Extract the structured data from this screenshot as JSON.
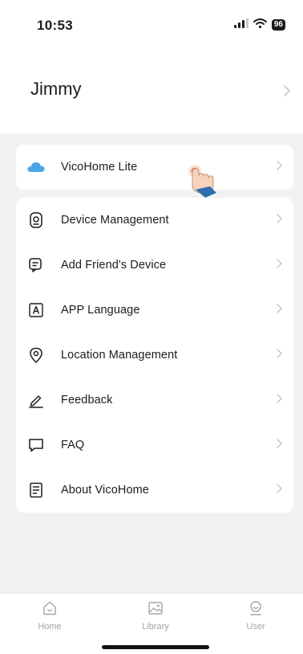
{
  "status_bar": {
    "time": "10:53",
    "battery": "96",
    "icons": [
      "signal-icon",
      "wifi-icon",
      "battery-icon"
    ]
  },
  "header": {
    "user_name": "Jimmy"
  },
  "top_card": {
    "label": "VicoHome Lite",
    "icon": "cloud-icon"
  },
  "menu": {
    "items": [
      {
        "label": "Device Management",
        "icon": "camera-icon"
      },
      {
        "label": "Add Friend's Device",
        "icon": "share-device-icon"
      },
      {
        "label": "APP Language",
        "icon": "language-icon"
      },
      {
        "label": "Location Management",
        "icon": "location-pin-icon"
      },
      {
        "label": "Feedback",
        "icon": "pen-icon"
      },
      {
        "label": "FAQ",
        "icon": "chat-bubble-icon"
      },
      {
        "label": "About VicoHome",
        "icon": "document-icon"
      }
    ]
  },
  "tab_bar": {
    "tabs": [
      {
        "label": "Home",
        "icon": "home-icon"
      },
      {
        "label": "Library",
        "icon": "image-icon"
      },
      {
        "label": "User",
        "icon": "user-icon"
      }
    ]
  },
  "colors": {
    "accent_cloud": "#4aa5e8",
    "chevron": "#c4c4c8",
    "background": "#f2f2f4",
    "tab_inactive": "#a4a4a8"
  }
}
